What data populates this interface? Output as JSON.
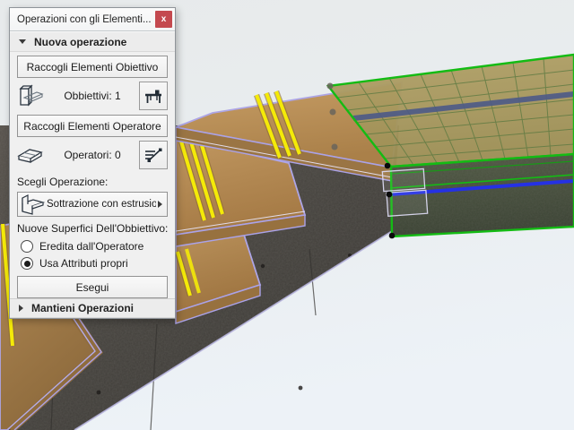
{
  "window": {
    "title": "Operazioni con gli Elementi...",
    "close_label": "x"
  },
  "palette": {
    "section_new_operation": "Nuova operazione",
    "collect_targets_button": "Raccogli Elementi Obiettivo",
    "targets_count": "Obbiettivi: 1",
    "collect_operators_button": "Raccogli Elementi Operatore",
    "operators_count": "Operatori: 0",
    "choose_operation_label": "Scegli Operazione:",
    "operation_selected": "Sottrazione con estrusio...",
    "new_surfaces_label": "Nuove Superfici Dell'Obbiettivo:",
    "radios": [
      {
        "label": "Eredita dall'Operatore",
        "selected": false
      },
      {
        "label": "Usa Attributi propri",
        "selected": true
      }
    ],
    "execute_button": "Esegui",
    "section_keep_operations": "Mantieni Operazioni"
  },
  "colors": {
    "palette_bg": "#f0f0f0",
    "titlebar_bg": "#fbfbfb",
    "close_button_red": "#c4494f",
    "selection_green": "#14bb14",
    "selection_blue": "#2531e4",
    "prehighlight_purple": "#aaa2e8",
    "stripe_yellow": "#f2e606",
    "wood_tan": "#b68d55",
    "concrete_gray": "#46433f",
    "slab_top_tan": "#ab9a5e",
    "viewport_bg_top": "#e7eaeb",
    "viewport_bg_bottom": "#edf2f7"
  }
}
